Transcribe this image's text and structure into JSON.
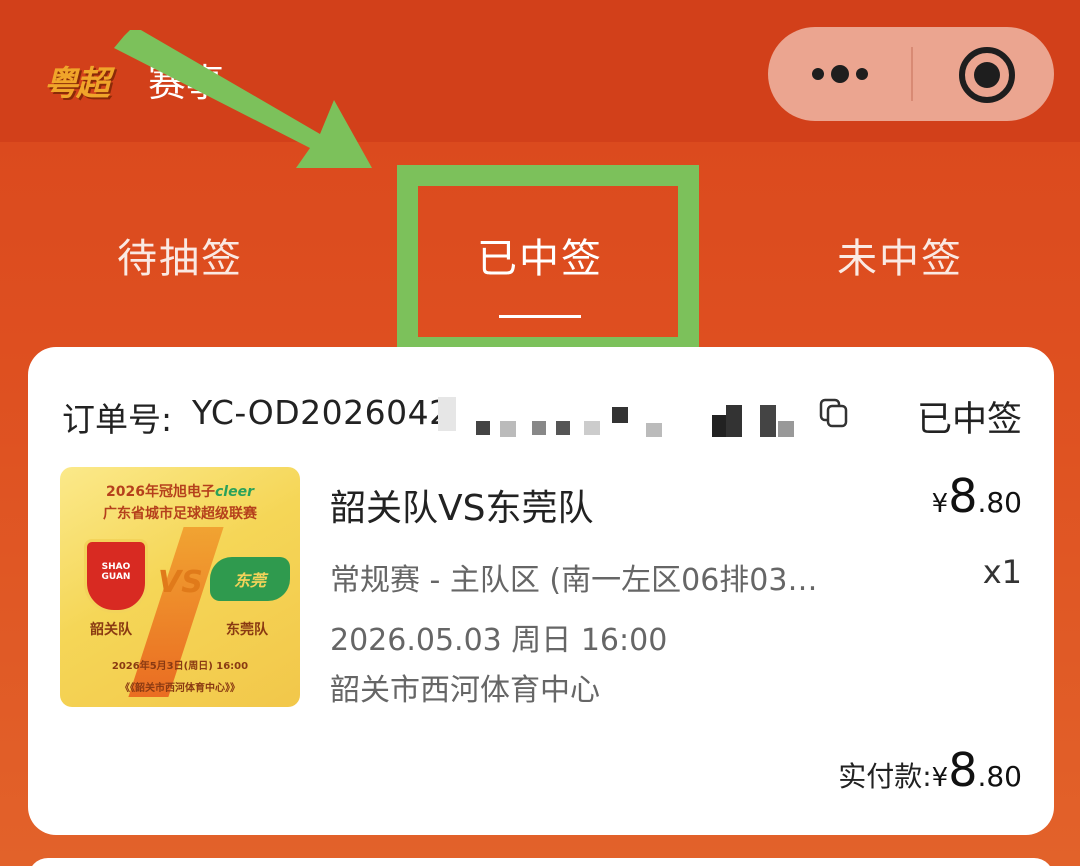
{
  "header": {
    "logo_text": "粤超",
    "title": "赛事",
    "more_icon": "more-dots-icon",
    "close_icon": "target-close-icon"
  },
  "tabs": [
    {
      "label": "待抽签",
      "active": false
    },
    {
      "label": "已中签",
      "active": true
    },
    {
      "label": "未中签",
      "active": false
    }
  ],
  "order": {
    "number_label": "订单号:",
    "number_visible": "YC-OD2026042",
    "status": "已中签",
    "copy_icon": "copy-icon",
    "poster": {
      "title_line1": "2026年冠旭电子",
      "brand": "cleer",
      "title_line2": "广东省城市足球超级联赛",
      "home_badge": "SHAO GUAN",
      "vs": "VS",
      "away_badge": "东莞",
      "home_team": "韶关队",
      "away_team": "东莞队",
      "date": "2026年5月3日(周日) 16:00",
      "venue": "《《韶关市西河体育中心》》"
    },
    "match_title": "韶关队VS东莞队",
    "price": {
      "currency": "¥",
      "integer": "8",
      "decimal": ".80"
    },
    "seat_info": "常规赛 - 主队区 (南一左区06排03…",
    "quantity": "x1",
    "match_time": "2026.05.03 周日 16:00",
    "venue": "韶关市西河体育中心",
    "paid": {
      "label": "实付款:",
      "currency": "¥",
      "integer": "8",
      "decimal": ".80"
    }
  },
  "annotation": {
    "arrow_color": "#7cc15b",
    "highlight_color": "#7cc15b"
  },
  "colors": {
    "header_bg": "#d2401a",
    "page_bg": "#de4f20",
    "card_bg": "#ffffff",
    "text_primary": "#222222",
    "text_secondary": "#666666"
  }
}
